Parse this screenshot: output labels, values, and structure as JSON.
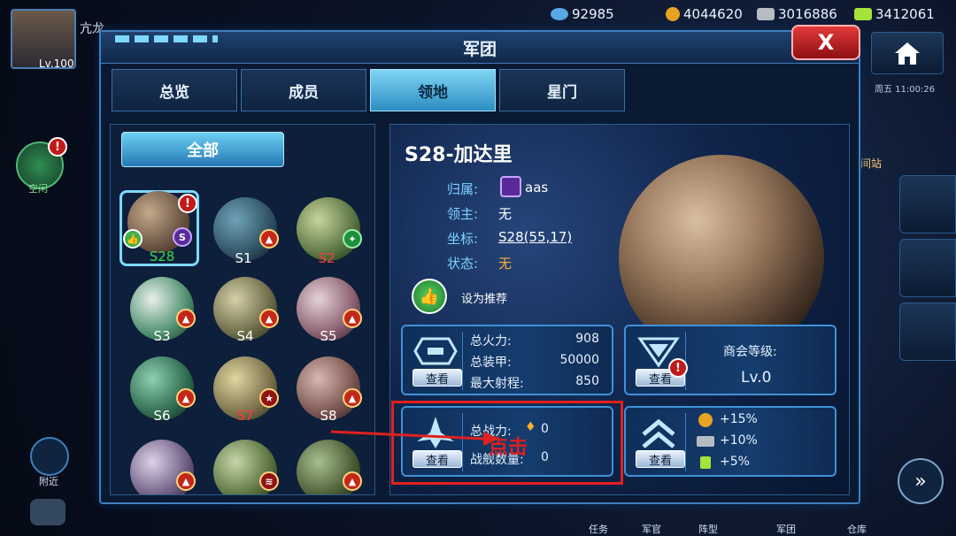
{
  "player": {
    "name": "亢龙",
    "level": "Lv.100"
  },
  "resources": {
    "gems": "92985",
    "gold": "4044620",
    "metal": "3016886",
    "energy": "3412061"
  },
  "clock": "周五 11:00:26",
  "left_hud": {
    "idle_label": "空闲",
    "nearby_label": "附近"
  },
  "side": {
    "station_label": "间站"
  },
  "bottom_tabs": [
    "任务",
    "军官",
    "阵型",
    "军团",
    "仓库"
  ],
  "window": {
    "title": "军团",
    "close": "X"
  },
  "tabs": [
    {
      "label": "总览"
    },
    {
      "label": "成员"
    },
    {
      "label": "领地"
    },
    {
      "label": "星门"
    }
  ],
  "filter": {
    "all_label": "全部"
  },
  "planets": [
    {
      "name": "S28",
      "color": "#3cd64a"
    },
    {
      "name": "S1",
      "color": "#ffffff"
    },
    {
      "name": "S2",
      "color": "#ff3b3b"
    },
    {
      "name": "S3",
      "color": "#ffffff"
    },
    {
      "name": "S4",
      "color": "#ffffff"
    },
    {
      "name": "S5",
      "color": "#ffffff"
    },
    {
      "name": "S6",
      "color": "#ffffff"
    },
    {
      "name": "S7",
      "color": "#ff3b3b"
    },
    {
      "name": "S8",
      "color": "#ffffff"
    },
    {
      "name": "",
      "color": "#ffffff"
    },
    {
      "name": "",
      "color": "#ffffff"
    },
    {
      "name": "",
      "color": "#ffffff"
    }
  ],
  "detail": {
    "title": "S28-加达里",
    "owner_label": "归属:",
    "owner_value": "aas",
    "lord_label": "领主:",
    "lord_value": "无",
    "coord_label": "坐标:",
    "coord_value": "S28(55,17)",
    "status_label": "状态:",
    "status_value": "无",
    "recommend_label": "设为推荐"
  },
  "stats": {
    "firepower_label": "总火力:",
    "firepower": "908",
    "armor_label": "总装甲:",
    "armor": "50000",
    "range_label": "最大射程:",
    "range": "850",
    "guild_label": "商会等级:",
    "guild_level": "Lv.0",
    "power_label": "总战力:",
    "power": "0",
    "ships_label": "战舰数量:",
    "ships": "0",
    "bonus": [
      "+15%",
      "+10%",
      "+5%"
    ],
    "view_label": "查看"
  },
  "annotation": {
    "text": "点击",
    "color": "#e02020"
  }
}
